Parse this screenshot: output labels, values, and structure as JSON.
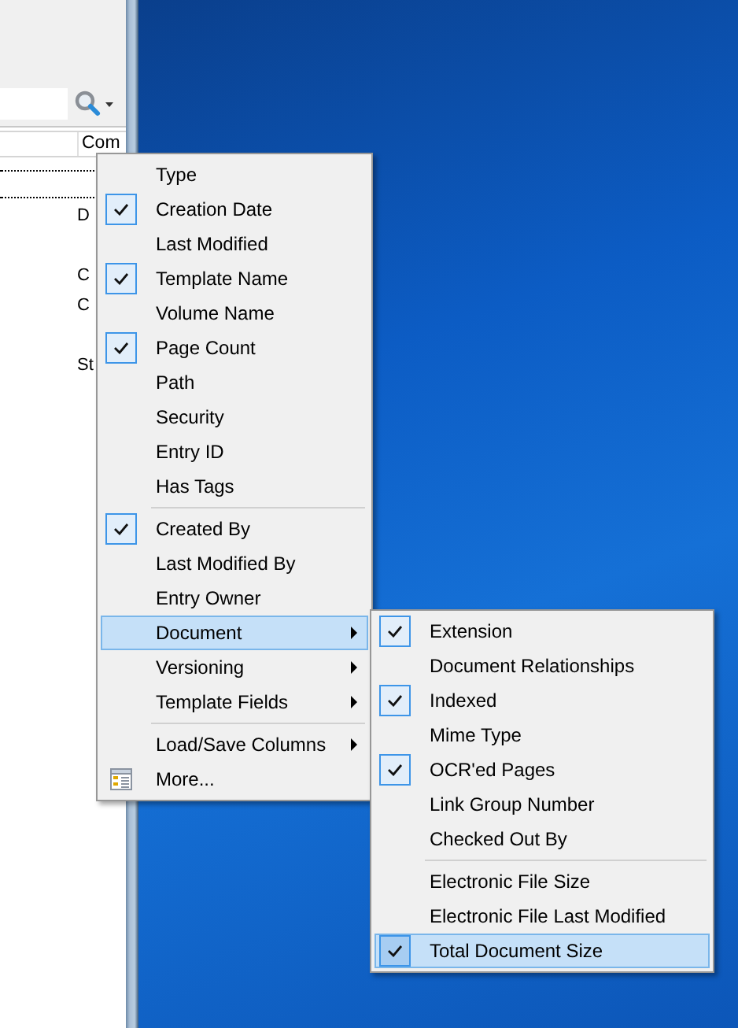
{
  "background_window": {
    "column_header": "Com",
    "list_groups": [
      [
        "D"
      ],
      [
        "C",
        "C"
      ],
      [
        "St"
      ]
    ]
  },
  "context_menu": {
    "items": [
      {
        "kind": "check",
        "label": "Type",
        "checked": false,
        "selected": false
      },
      {
        "kind": "check",
        "label": "Creation Date",
        "checked": true,
        "selected": false
      },
      {
        "kind": "check",
        "label": "Last Modified",
        "checked": false,
        "selected": false
      },
      {
        "kind": "check",
        "label": "Template Name",
        "checked": true,
        "selected": false
      },
      {
        "kind": "check",
        "label": "Volume Name",
        "checked": false,
        "selected": false
      },
      {
        "kind": "check",
        "label": "Page Count",
        "checked": true,
        "selected": false
      },
      {
        "kind": "check",
        "label": "Path",
        "checked": false,
        "selected": false
      },
      {
        "kind": "check",
        "label": "Security",
        "checked": false,
        "selected": false
      },
      {
        "kind": "check",
        "label": "Entry ID",
        "checked": false,
        "selected": false
      },
      {
        "kind": "check",
        "label": "Has Tags",
        "checked": false,
        "selected": false
      },
      {
        "kind": "separator"
      },
      {
        "kind": "check",
        "label": "Created By",
        "checked": true,
        "selected": false
      },
      {
        "kind": "check",
        "label": "Last Modified By",
        "checked": false,
        "selected": false
      },
      {
        "kind": "check",
        "label": "Entry Owner",
        "checked": false,
        "selected": false
      },
      {
        "kind": "submenu",
        "label": "Document",
        "selected": true
      },
      {
        "kind": "submenu",
        "label": "Versioning",
        "selected": false
      },
      {
        "kind": "submenu",
        "label": "Template Fields",
        "selected": false
      },
      {
        "kind": "separator"
      },
      {
        "kind": "submenu",
        "label": "Load/Save Columns",
        "selected": false
      },
      {
        "kind": "command",
        "label": "More...",
        "selected": false
      }
    ]
  },
  "submenu": {
    "items": [
      {
        "kind": "check",
        "label": "Extension",
        "checked": true,
        "selected": false
      },
      {
        "kind": "check",
        "label": "Document Relationships",
        "checked": false,
        "selected": false
      },
      {
        "kind": "check",
        "label": "Indexed",
        "checked": true,
        "selected": false
      },
      {
        "kind": "check",
        "label": "Mime Type",
        "checked": false,
        "selected": false
      },
      {
        "kind": "check",
        "label": "OCR'ed Pages",
        "checked": true,
        "selected": false
      },
      {
        "kind": "check",
        "label": "Link Group Number",
        "checked": false,
        "selected": false
      },
      {
        "kind": "check",
        "label": "Checked Out By",
        "checked": false,
        "selected": false
      },
      {
        "kind": "separator"
      },
      {
        "kind": "check",
        "label": "Electronic File Size",
        "checked": false,
        "selected": false
      },
      {
        "kind": "check",
        "label": "Electronic File Last Modified",
        "checked": false,
        "selected": false
      },
      {
        "kind": "check",
        "label": "Total Document Size",
        "checked": true,
        "selected": true
      }
    ]
  }
}
